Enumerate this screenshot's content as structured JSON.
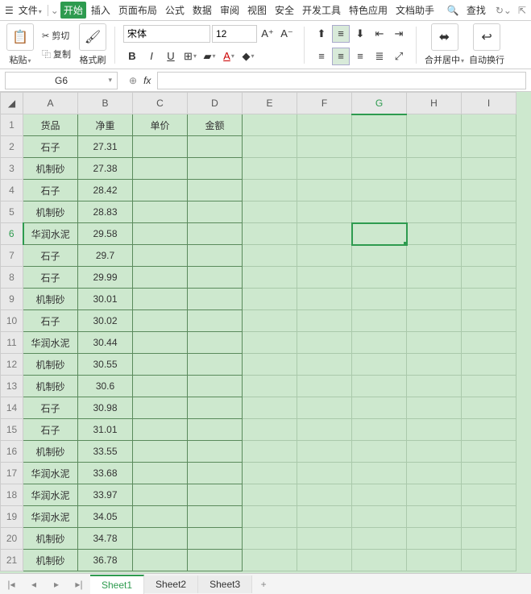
{
  "menu": {
    "file": "文件",
    "tabs": [
      "开始",
      "插入",
      "页面布局",
      "公式",
      "数据",
      "审阅",
      "视图",
      "安全",
      "开发工具",
      "特色应用",
      "文档助手"
    ],
    "find": "查找"
  },
  "clip": {
    "paste": "粘贴",
    "cut": "剪切",
    "copy": "复制",
    "format": "格式刷"
  },
  "font": {
    "name": "宋体",
    "size": "12"
  },
  "align": {
    "merge": "合并居中",
    "wrap": "自动换行"
  },
  "ref": {
    "cell": "G6"
  },
  "headers": [
    "A",
    "B",
    "C",
    "D",
    "E",
    "F",
    "G",
    "H",
    "I"
  ],
  "row1": {
    "A": "货品",
    "B": "净重",
    "C": "单价",
    "D": "金额"
  },
  "rows": [
    {
      "n": "2",
      "A": "石子",
      "B": "27.31"
    },
    {
      "n": "3",
      "A": "机制砂",
      "B": "27.38"
    },
    {
      "n": "4",
      "A": "石子",
      "B": "28.42"
    },
    {
      "n": "5",
      "A": "机制砂",
      "B": "28.83"
    },
    {
      "n": "6",
      "A": "华润水泥",
      "B": "29.58"
    },
    {
      "n": "7",
      "A": "石子",
      "B": "29.7"
    },
    {
      "n": "8",
      "A": "石子",
      "B": "29.99"
    },
    {
      "n": "9",
      "A": "机制砂",
      "B": "30.01"
    },
    {
      "n": "10",
      "A": "石子",
      "B": "30.02"
    },
    {
      "n": "11",
      "A": "华润水泥",
      "B": "30.44"
    },
    {
      "n": "12",
      "A": "机制砂",
      "B": "30.55"
    },
    {
      "n": "13",
      "A": "机制砂",
      "B": "30.6"
    },
    {
      "n": "14",
      "A": "石子",
      "B": "30.98"
    },
    {
      "n": "15",
      "A": "石子",
      "B": "31.01"
    },
    {
      "n": "16",
      "A": "机制砂",
      "B": "33.55"
    },
    {
      "n": "17",
      "A": "华润水泥",
      "B": "33.68"
    },
    {
      "n": "18",
      "A": "华润水泥",
      "B": "33.97"
    },
    {
      "n": "19",
      "A": "华润水泥",
      "B": "34.05"
    },
    {
      "n": "20",
      "A": "机制砂",
      "B": "34.78"
    },
    {
      "n": "21",
      "A": "机制砂",
      "B": "36.78"
    }
  ],
  "sheets": [
    "Sheet1",
    "Sheet2",
    "Sheet3"
  ]
}
